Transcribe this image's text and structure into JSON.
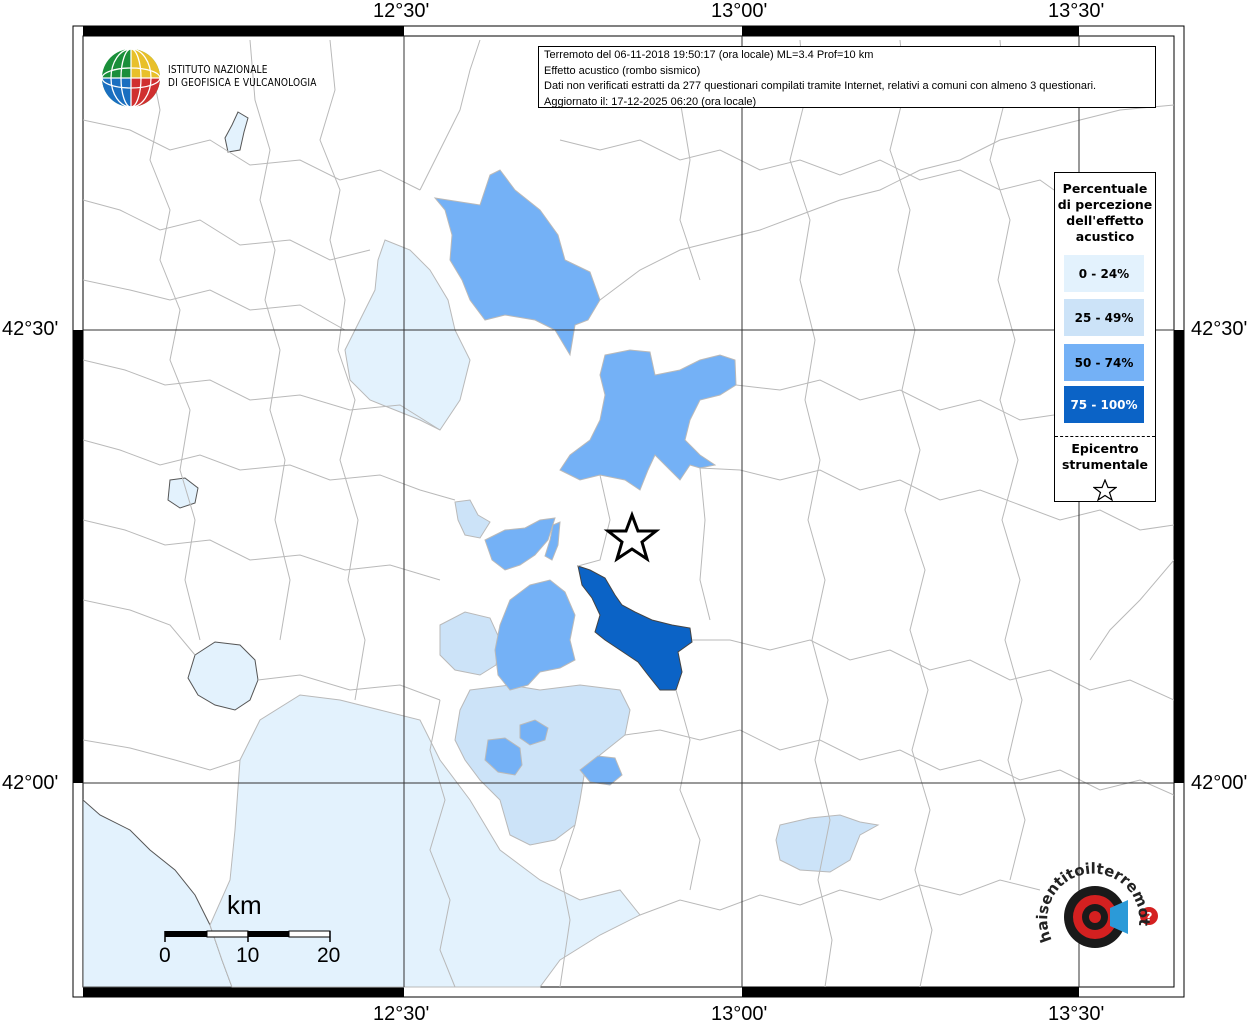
{
  "info": {
    "line1": "Terremoto del 06-11-2018 19:50:17 (ora locale) ML=3.4 Prof=10 km",
    "line2": "Effetto acustico (rombo sismico)",
    "line3": "Dati non verificati estratti da 277 questionari compilati tramite Internet, relativi a comuni con almeno 3 questionari.",
    "line4": "Aggiornato il: 17-12-2025 06:20 (ora locale)"
  },
  "axes": {
    "lon_top": [
      "12°30'",
      "13°00'",
      "13°30'"
    ],
    "lon_bottom": [
      "12°30'",
      "13°00'",
      "13°30'"
    ],
    "lat_left": [
      "42°30'",
      "42°00'"
    ],
    "lat_right": [
      "42°30'",
      "42°00'"
    ]
  },
  "logo": {
    "line1": "ISTITUTO NAZIONALE",
    "line2": "DI GEOFISICA E VULCANOLOGIA",
    "watermark": "haisentitoilterremoto.it www."
  },
  "legend": {
    "title_lines": [
      "Percentuale",
      "di percezione",
      "dell'effetto",
      "acustico"
    ],
    "classes": [
      {
        "label": "0 - 24%",
        "color": "#e3f2fd",
        "text_color": "#000000"
      },
      {
        "label": "25 - 49%",
        "color": "#cce3f8",
        "text_color": "#000000"
      },
      {
        "label": "50 - 74%",
        "color": "#74b1f6",
        "text_color": "#000000"
      },
      {
        "label": "75 - 100%",
        "color": "#0b63c6",
        "text_color": "#ffffff"
      }
    ],
    "epicenter_lines": [
      "Epicentro",
      "strumentale"
    ]
  },
  "scale": {
    "unit": "km",
    "ticks": [
      "0",
      "10",
      "20"
    ]
  },
  "colors": {
    "sea": "#e3f2fd",
    "boundary": "#b9b9b9",
    "frame": "#000000"
  }
}
